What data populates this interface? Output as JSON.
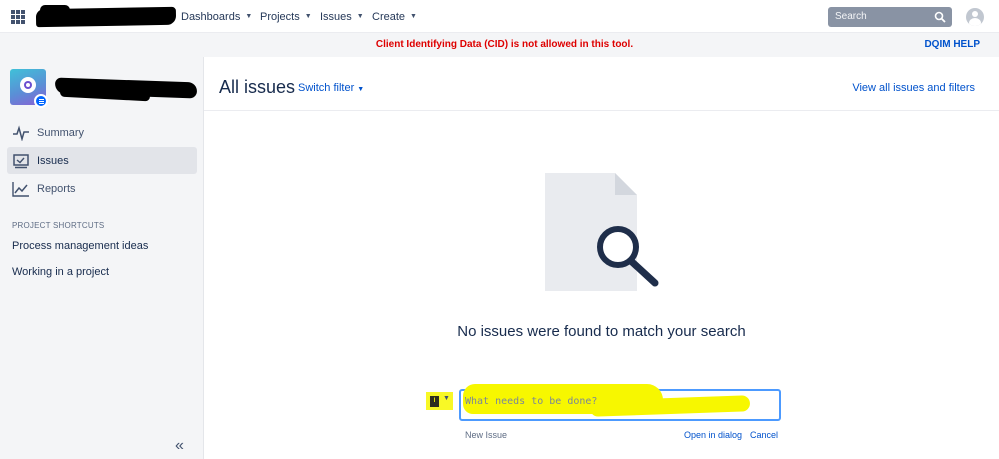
{
  "topnav": {
    "menus": [
      {
        "label": "Dashboards"
      },
      {
        "label": "Projects"
      },
      {
        "label": "Issues"
      },
      {
        "label": "Create"
      }
    ],
    "search_placeholder": "Search"
  },
  "banner": {
    "message": "Client Identifying Data (CID) is not allowed in this tool.",
    "help_link": "DQIM HELP"
  },
  "sidebar": {
    "nav": [
      {
        "label": "Summary",
        "icon": "pulse-icon"
      },
      {
        "label": "Issues",
        "icon": "issues-board-icon",
        "active": true
      },
      {
        "label": "Reports",
        "icon": "chart-line-icon"
      }
    ],
    "shortcuts_heading": "PROJECT SHORTCUTS",
    "shortcuts": [
      {
        "label": "Process management ideas"
      },
      {
        "label": "Working in a project"
      }
    ],
    "collapse_glyph": "«"
  },
  "main": {
    "title": "All issues",
    "switch_filter": "Switch filter",
    "view_all": "View all issues and filters",
    "empty_message": "No issues were found to match your search",
    "create": {
      "type_label": "I",
      "placeholder": "What needs to be done?",
      "new_issue_label": "New Issue",
      "open_dialog": "Open in dialog",
      "cancel": "Cancel"
    }
  },
  "colors": {
    "link": "#0052cc",
    "banner_warning": "#de0000",
    "highlight": "#f7f700",
    "focus_border": "#4c9aff"
  }
}
